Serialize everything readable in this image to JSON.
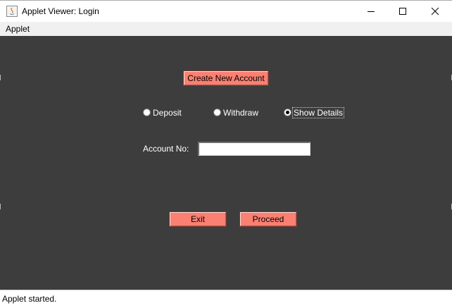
{
  "window": {
    "title": "Applet Viewer: Login",
    "icon": "java-cup-icon",
    "controls": [
      "minimize-icon",
      "maximize-icon",
      "close-icon"
    ]
  },
  "menubar": {
    "items": [
      {
        "label": "Applet"
      }
    ]
  },
  "applet": {
    "background_color": "#3d3d3d",
    "button_color": "#fa8072",
    "create_account_label": "Create New Account",
    "options": [
      {
        "label": "Deposit",
        "checked": false
      },
      {
        "label": "Withdraw",
        "checked": false
      },
      {
        "label": "Show Details",
        "checked": true
      }
    ],
    "account_no_label": "Account No:",
    "account_no_value": "",
    "exit_label": "Exit",
    "proceed_label": "Proceed"
  },
  "status": {
    "text": "Applet started."
  }
}
